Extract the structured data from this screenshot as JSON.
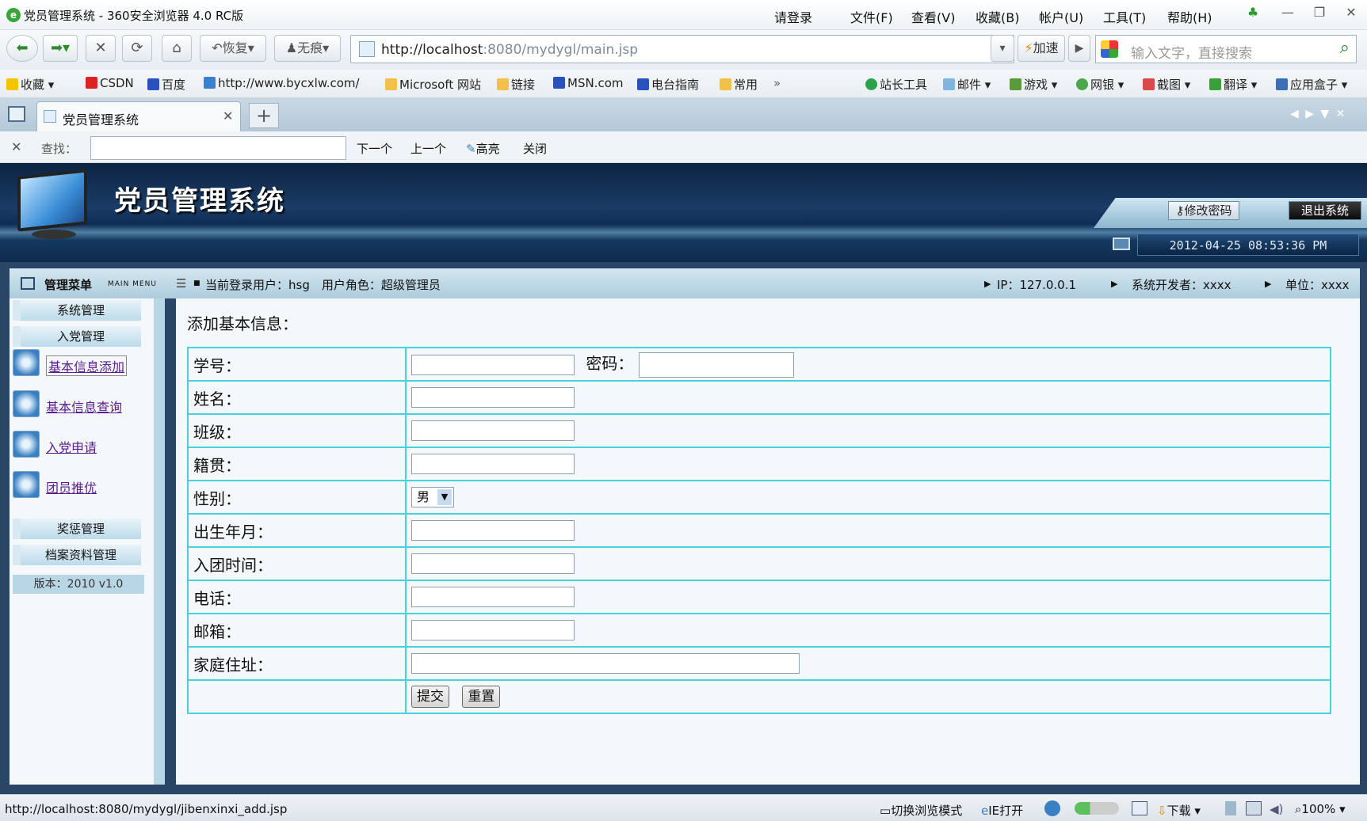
{
  "browser": {
    "title": "党员管理系统 - 360安全浏览器 4.0 RC版",
    "menus": [
      "请登录",
      "文件(F)",
      "查看(V)",
      "收藏(B)",
      "帐户(U)",
      "工具(T)",
      "帮助(H)"
    ],
    "nav": {
      "restore": "恢复",
      "incognito": "无痕"
    },
    "address": {
      "host": "http://localhost",
      "rest": ":8080/mydygl/main.jsp"
    },
    "speedup": "加速",
    "search_placeholder": "输入文字，直接搜索",
    "bookmarks": [
      "收藏",
      "CSDN",
      "百度",
      "http://www.bycxlw.com/",
      "Microsoft 网站",
      "链接",
      "MSN.com",
      "电台指南",
      "常用",
      "»"
    ],
    "toolbar_right": [
      "站长工具",
      "邮件",
      "游戏",
      "网银",
      "截图",
      "翻译",
      "应用盒子"
    ],
    "tab_title": "党员管理系统",
    "find": {
      "label": "查找：",
      "next": "下一个",
      "prev": "上一个",
      "highlight": "高亮",
      "close": "关闭"
    },
    "status": {
      "url": "http://localhost:8080/mydygl/jibenxinxi_add.jsp",
      "switch_mode": "切换浏览模式",
      "ie_open": "IE打开",
      "download": "下载",
      "zoom": "100%"
    }
  },
  "app": {
    "title": "党员管理系统",
    "change_password": "修改密码",
    "logout": "退出系统",
    "datetime": "2012-04-25 08:53:36 PM",
    "menu_title": "管理菜单",
    "menu_sub": "MAIN MENU",
    "user_info": "当前登录用户：hsg　用户角色：超级管理员",
    "ip": "IP：127.0.0.1",
    "developer": "系统开发者：xxxx",
    "unit": "单位：xxxx",
    "sidebar": {
      "headers": [
        "系统管理",
        "入党管理",
        "奖惩管理",
        "档案资料管理"
      ],
      "links": [
        "基本信息添加",
        "基本信息查询",
        "入党申请",
        "团员推优"
      ],
      "version": "版本：2010 v1.0"
    },
    "form": {
      "title": "添加基本信息：",
      "fields": {
        "student_id": "学号：",
        "password": "密码：",
        "name": "姓名：",
        "class": "班级：",
        "native": "籍贯：",
        "gender": "性别：",
        "birth": "出生年月：",
        "league_date": "入团时间：",
        "phone": "电话：",
        "email": "邮箱：",
        "address": "家庭住址："
      },
      "gender_value": "男",
      "submit": "提交",
      "reset": "重置"
    }
  }
}
